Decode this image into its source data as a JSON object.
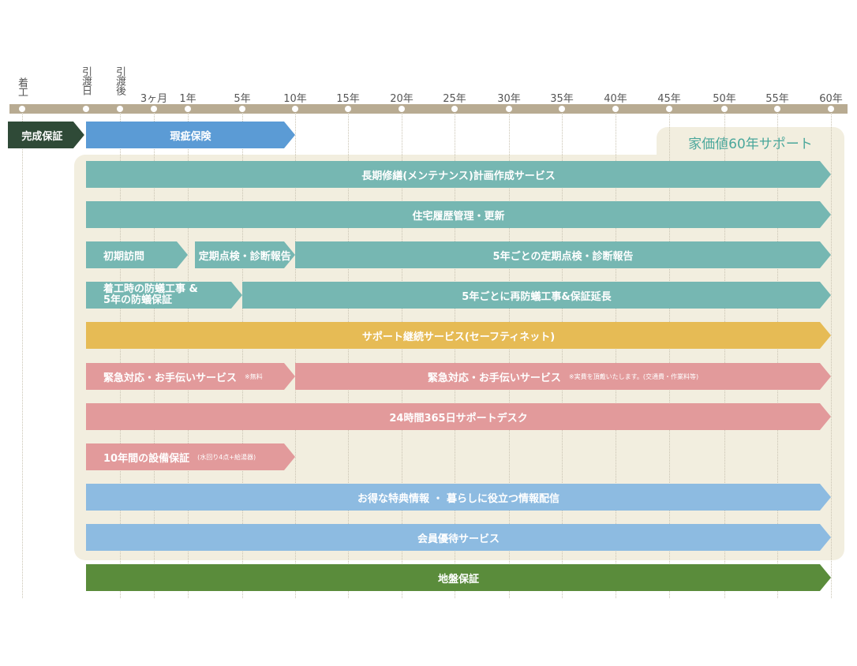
{
  "axis": {
    "ticks": [
      {
        "label": "着工",
        "vertical": true,
        "x": -1.92
      },
      {
        "label": "引渡日",
        "vertical": true,
        "x": 0
      },
      {
        "label": "引渡後",
        "vertical": true,
        "x": 0.5
      },
      {
        "label": "3ヶ月",
        "x": 1
      },
      {
        "label": "1年",
        "x": 1.5
      },
      {
        "label": "5年",
        "x": 2.3
      },
      {
        "label": "10年",
        "x": 3
      },
      {
        "label": "15年",
        "x": 3.8
      },
      {
        "label": "20年",
        "x": 4.6
      },
      {
        "label": "25年",
        "x": 5.4
      },
      {
        "label": "30年",
        "x": 6.2
      },
      {
        "label": "35年",
        "x": 7
      },
      {
        "label": "40年",
        "x": 7.8
      },
      {
        "label": "45年",
        "x": 8.6
      },
      {
        "label": "50年",
        "x": 9.4
      },
      {
        "label": "55年",
        "x": 10.1
      },
      {
        "label": "60年",
        "x": 10.9
      }
    ]
  },
  "support_title": "家価値60年サポート",
  "colors": {
    "dark_green": "#2f4a37",
    "blue": "#5b9bd5",
    "teal": "#76b7b2",
    "gold": "#e6bb55",
    "pink": "#e29a9b",
    "light_blue": "#8dbbe1",
    "green": "#5a8c3b"
  },
  "bars": [
    {
      "name": "completion-guarantee-bar",
      "label": "完成保証",
      "start": -2.35,
      "end": -0.05,
      "row": 0,
      "color": "dark_green"
    },
    {
      "name": "defect-insurance-bar",
      "label": "瑕疵保険",
      "start": 0,
      "end": 3,
      "row": 0,
      "color": "blue"
    },
    {
      "name": "long-term-repair-plan-bar",
      "label": "長期修繕(メンテナンス)計画作成サービス",
      "start": 0,
      "end": 10.9,
      "row": 1,
      "color": "teal"
    },
    {
      "name": "housing-history-bar",
      "label": "住宅履歴管理・更新",
      "start": 0,
      "end": 10.9,
      "row": 2,
      "color": "teal"
    },
    {
      "name": "initial-visit-bar",
      "label": "初期訪問",
      "start": 0,
      "end": 1.5,
      "row": 3,
      "color": "teal"
    },
    {
      "name": "periodic-inspection-bar",
      "label": "定期点検・診断報告",
      "start": 1.6,
      "end": 3,
      "row": 3,
      "color": "teal"
    },
    {
      "name": "five-year-inspection-bar",
      "label": "5年ごとの定期点検・診断報告",
      "start": 3,
      "end": 10.9,
      "row": 3,
      "color": "teal"
    },
    {
      "name": "termite-initial-bar",
      "label": "着工時の防蟻工事 &",
      "label2": "5年の防蟻保証",
      "start": 0,
      "end": 2.3,
      "row": 4,
      "color": "teal"
    },
    {
      "name": "termite-renewal-bar",
      "label": "5年ごとに再防蟻工事&保証延長",
      "start": 2.3,
      "end": 10.9,
      "row": 4,
      "color": "teal"
    },
    {
      "name": "support-continuation-bar",
      "label": "サポート継続サービス(セーフティネット)",
      "start": 0,
      "end": 10.9,
      "row": 5,
      "color": "gold"
    },
    {
      "name": "emergency-free-bar",
      "label": "緊急対応・お手伝いサービス",
      "note": "※無料",
      "start": 0,
      "end": 3,
      "row": 6,
      "color": "pink"
    },
    {
      "name": "emergency-paid-bar",
      "label": "緊急対応・お手伝いサービス",
      "note": "※実費を頂戴いたします。(交通費・作業料等)",
      "start": 3,
      "end": 10.9,
      "row": 6,
      "color": "pink"
    },
    {
      "name": "support-desk-bar",
      "label": "24時間365日サポートデスク",
      "start": 0,
      "end": 10.9,
      "row": 7,
      "color": "pink"
    },
    {
      "name": "equipment-guarantee-bar",
      "label": "10年間の設備保証",
      "note": "(水回り4点+給湯器)",
      "start": 0,
      "end": 3,
      "row": 8,
      "color": "pink"
    },
    {
      "name": "benefit-info-bar",
      "label": "お得な特典情報 ・ 暮らしに役立つ情報配信",
      "start": 0,
      "end": 10.9,
      "row": 9,
      "color": "light_blue"
    },
    {
      "name": "member-service-bar",
      "label": "会員優待サービス",
      "start": 0,
      "end": 10.9,
      "row": 10,
      "color": "light_blue"
    },
    {
      "name": "ground-guarantee-bar",
      "label": "地盤保証",
      "start": 0,
      "end": 10.9,
      "row": 11,
      "color": "green"
    }
  ]
}
